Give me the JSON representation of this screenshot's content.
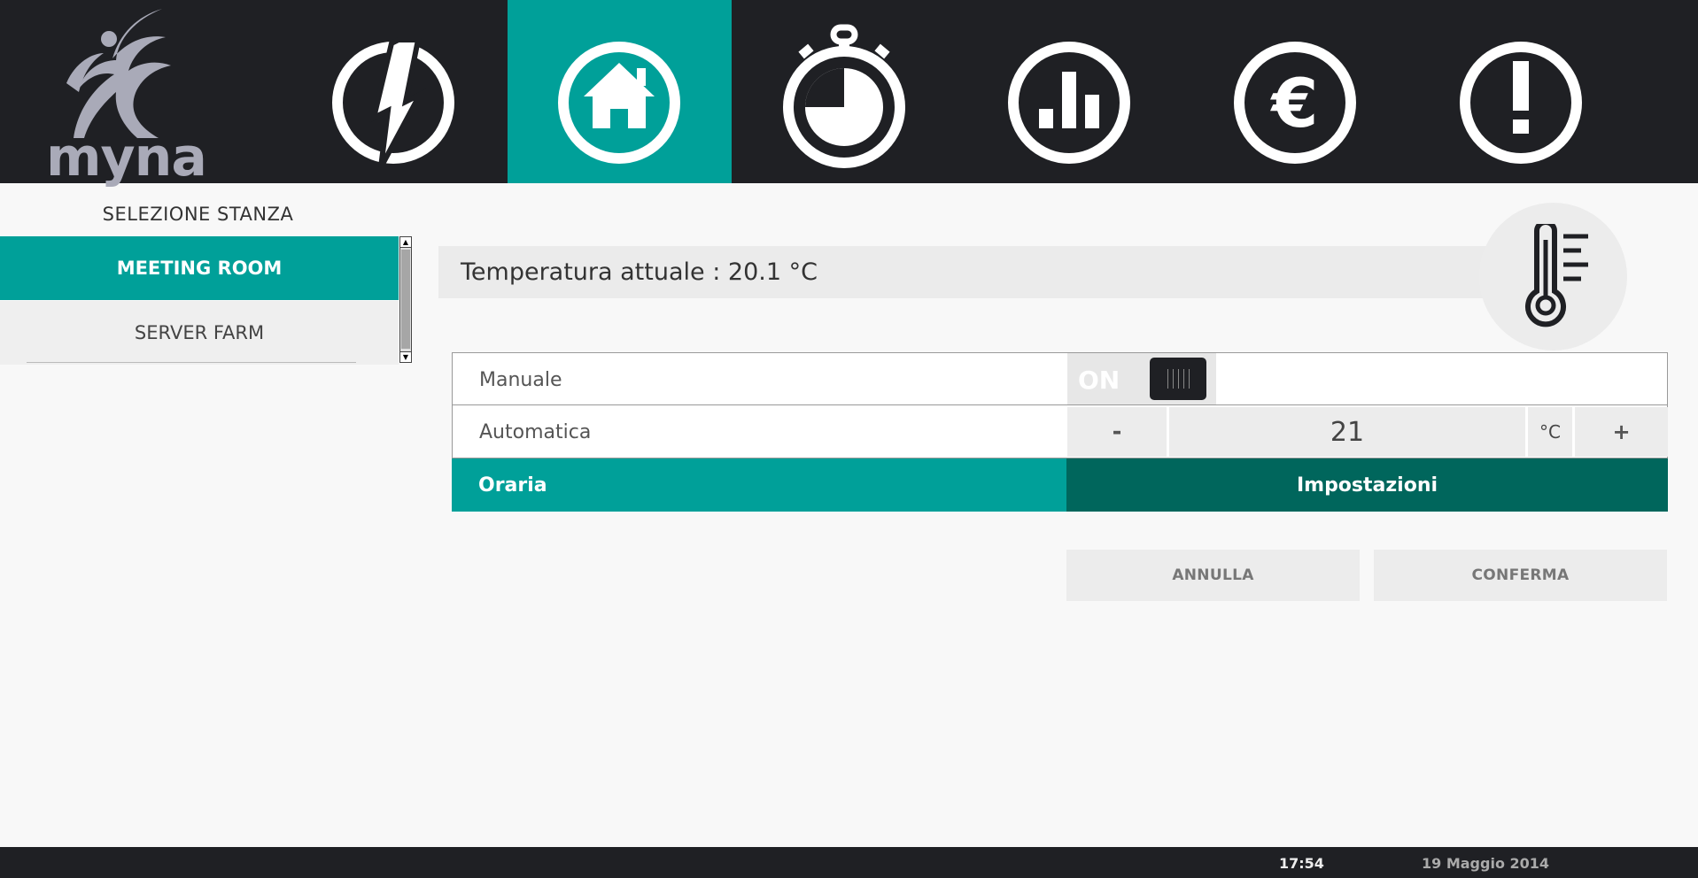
{
  "brand": {
    "name": "myna"
  },
  "nav": {
    "tabs": [
      {
        "id": "energy",
        "icon": "lightning-icon",
        "active": false
      },
      {
        "id": "home",
        "icon": "home-icon",
        "active": true
      },
      {
        "id": "timer",
        "icon": "stopwatch-icon",
        "active": false
      },
      {
        "id": "stats",
        "icon": "bar-chart-icon",
        "active": false
      },
      {
        "id": "cost",
        "icon": "euro-icon",
        "active": false
      },
      {
        "id": "alerts",
        "icon": "alert-icon",
        "active": false
      }
    ]
  },
  "sidebar": {
    "heading": "SELEZIONE STANZA",
    "rooms": [
      {
        "label": "MEETING ROOM",
        "selected": true
      },
      {
        "label": "SERVER FARM",
        "selected": false
      }
    ]
  },
  "temperature": {
    "label": "Temperatura attuale : 20.1 °C",
    "icon": "thermometer-icon"
  },
  "modes": {
    "manual": {
      "label": "Manuale",
      "toggle_text": "ON"
    },
    "automatic": {
      "label": "Automatica",
      "minus": "-",
      "setpoint": "21",
      "unit": "°C",
      "plus": "+"
    },
    "hourly": {
      "label": "Oraria",
      "settings": "Impostazioni"
    }
  },
  "actions": {
    "cancel": "ANNULLA",
    "confirm": "CONFERMA"
  },
  "footer": {
    "time": "17:54",
    "date": "19 Maggio 2014"
  },
  "colors": {
    "accent": "#00a099",
    "accent_dark": "#00665c",
    "bar": "#1f2024",
    "panel": "#ececec"
  }
}
